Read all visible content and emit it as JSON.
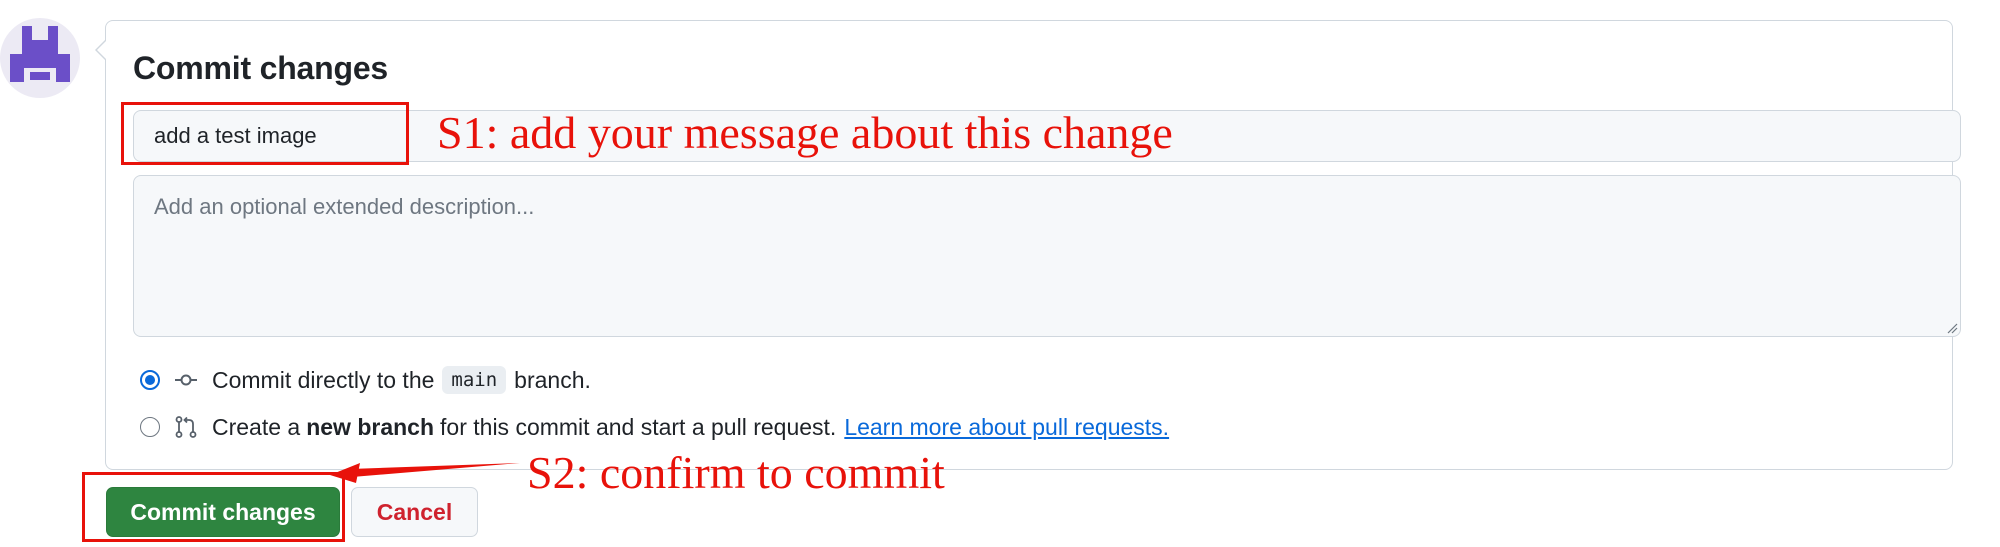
{
  "commit_form": {
    "title": "Commit changes",
    "message_value": "add a test image",
    "description_placeholder": "Add an optional extended description...",
    "options": [
      {
        "selected": true,
        "icon": "git-commit-icon",
        "text_before": "Commit directly to the",
        "branch": "main",
        "text_after": "branch."
      },
      {
        "selected": false,
        "icon": "git-pull-request-icon",
        "text_before": "Create a",
        "bold": "new branch",
        "text_after": "for this commit and start a pull request.",
        "link": "Learn more about pull requests."
      }
    ]
  },
  "actions": {
    "commit_label": "Commit changes",
    "cancel_label": "Cancel"
  },
  "annotations": {
    "step1": "S1: add your message about this change",
    "step2": "S2: confirm to commit"
  },
  "colors": {
    "annotation_red": "#e8120a",
    "commit_green": "#2e8540",
    "link_blue": "#0969da",
    "cancel_red": "#cf222e",
    "avatar_purple": "#6b4fc8"
  }
}
